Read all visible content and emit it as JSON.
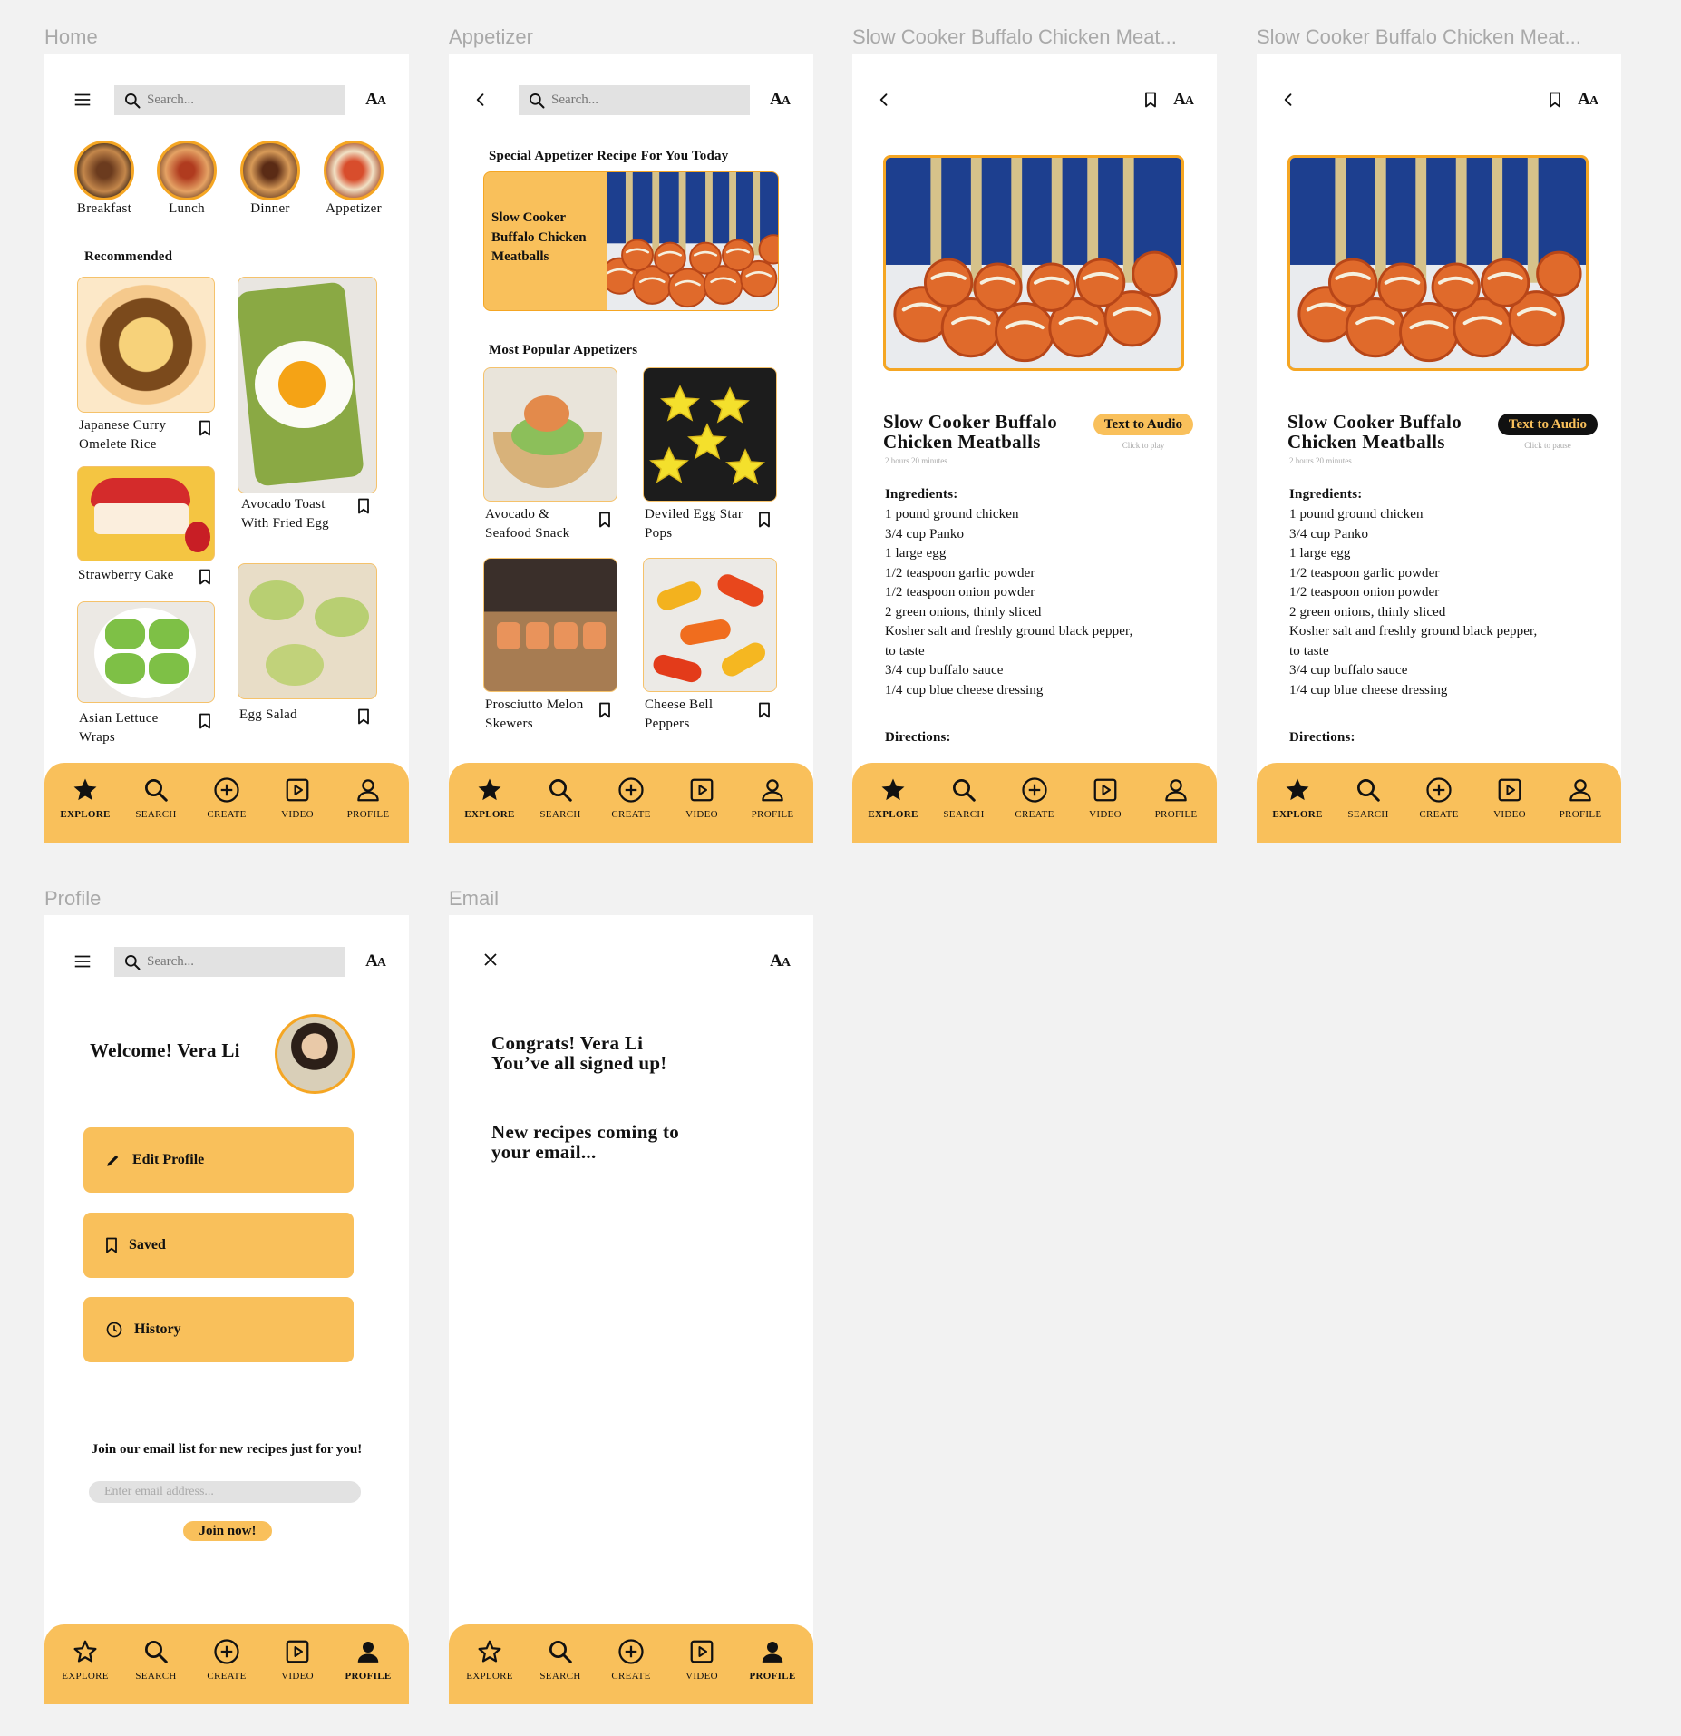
{
  "frames": {
    "home": "Home",
    "appetizer": "Appetizer",
    "detail1": "Slow Cooker Buffalo Chicken Meat...",
    "detail2": "Slow Cooker Buffalo Chicken Meat...",
    "profile": "Profile",
    "email": "Email"
  },
  "common": {
    "search_placeholder": "Search...",
    "font_size_label": "Aa"
  },
  "tabbar": {
    "explore": "EXPLORE",
    "search": "SEARCH",
    "create": "CREATE",
    "video": "VIDEO",
    "profile": "PROFILE"
  },
  "home": {
    "categories": [
      "Breakfast",
      "Lunch",
      "Dinner",
      "Appetizer"
    ],
    "recommended_heading": "Recommended",
    "recipes": {
      "curry": "Japanese Curry Omelete Rice",
      "avocado_toast": "Avocado Toast With Fried Egg",
      "strawberry_cake": "Strawberry Cake",
      "lettuce_wraps": "Asian Lettuce Wraps",
      "egg_salad": "Egg Salad"
    }
  },
  "appetizer": {
    "special_heading": "Special Appetizer Recipe For You Today",
    "special_title": "Slow Cooker Buffalo Chicken Meatballs",
    "popular_heading": "Most Popular Appetizers",
    "items": {
      "avocado_seafood": "Avocado & Seafood Snack",
      "deviled_egg": "Deviled Egg Star Pops",
      "prosciutto": "Prosciutto Melon Skewers",
      "cheese_peppers": "Cheese Bell Peppers"
    }
  },
  "recipe": {
    "title": "Slow Cooker Buffalo Chicken Meatballs",
    "time": "2 hours 20 minutes",
    "audio_label": "Text to Audio",
    "audio_hint_play": "Click to play",
    "audio_hint_pause": "Click to pause",
    "ingredients_heading": "Ingredients:",
    "ingredients": [
      "1 pound ground chicken",
      "3/4 cup Panko",
      "1 large egg",
      "1/2 teaspoon garlic powder",
      "1/2 teaspoon onion powder",
      "2 green onions, thinly sliced",
      "Kosher salt and freshly ground black pepper,",
      "to taste",
      "3/4 cup buffalo sauce",
      "1/4 cup blue cheese dressing"
    ],
    "directions_heading": "Directions:"
  },
  "profile": {
    "welcome": "Welcome! Vera Li",
    "edit_profile": "Edit Profile",
    "saved": "Saved",
    "history": "History",
    "email_prompt": "Join our email list for new recipes just for you!",
    "email_placeholder": "Enter email address...",
    "join_button": "Join now!"
  },
  "email": {
    "congrats_line1": "Congrats! Vera Li",
    "congrats_line2": "You’ve all signed up!",
    "coming_line1": "New recipes coming to",
    "coming_line2": "your email..."
  },
  "colors": {
    "accent": "#f9c05b",
    "accent_border": "#f5a623",
    "page_bg": "#f2f2f2",
    "search_bg": "#e2e2e2"
  },
  "icons": [
    "menu-icon",
    "search-icon",
    "back-arrow-icon",
    "bookmark-icon",
    "close-icon",
    "star-icon",
    "plus-circle-icon",
    "video-play-icon",
    "person-icon",
    "pencil-icon",
    "clock-icon"
  ]
}
